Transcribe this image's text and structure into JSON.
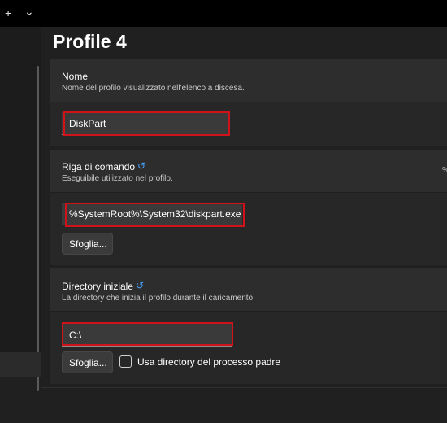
{
  "titlebar": {
    "new_tab_icon": "+",
    "dropdown_icon": "⌄"
  },
  "page": {
    "title": "Profile 4"
  },
  "name_section": {
    "label": "Nome",
    "description": "Nome del profilo visualizzato nell'elenco a discesa.",
    "value": "DiskPart"
  },
  "command_section": {
    "label": "Riga di comando",
    "reset_icon": "↺",
    "description": "Eseguibile utilizzato nel profilo.",
    "value": "%SystemRoot%\\System32\\diskpart.exe",
    "browse_label": "Sfoglia...",
    "side_text": "%"
  },
  "directory_section": {
    "label": "Directory iniziale",
    "reset_icon": "↺",
    "description": "La directory che inizia il profilo durante il caricamento.",
    "value": "C:\\",
    "browse_label": "Sfoglia...",
    "checkbox_label": "Usa directory del processo padre",
    "checkbox_checked": false
  },
  "colors": {
    "highlight": "#d0121b",
    "accent": "#4aa3ff",
    "background": "#202020"
  }
}
